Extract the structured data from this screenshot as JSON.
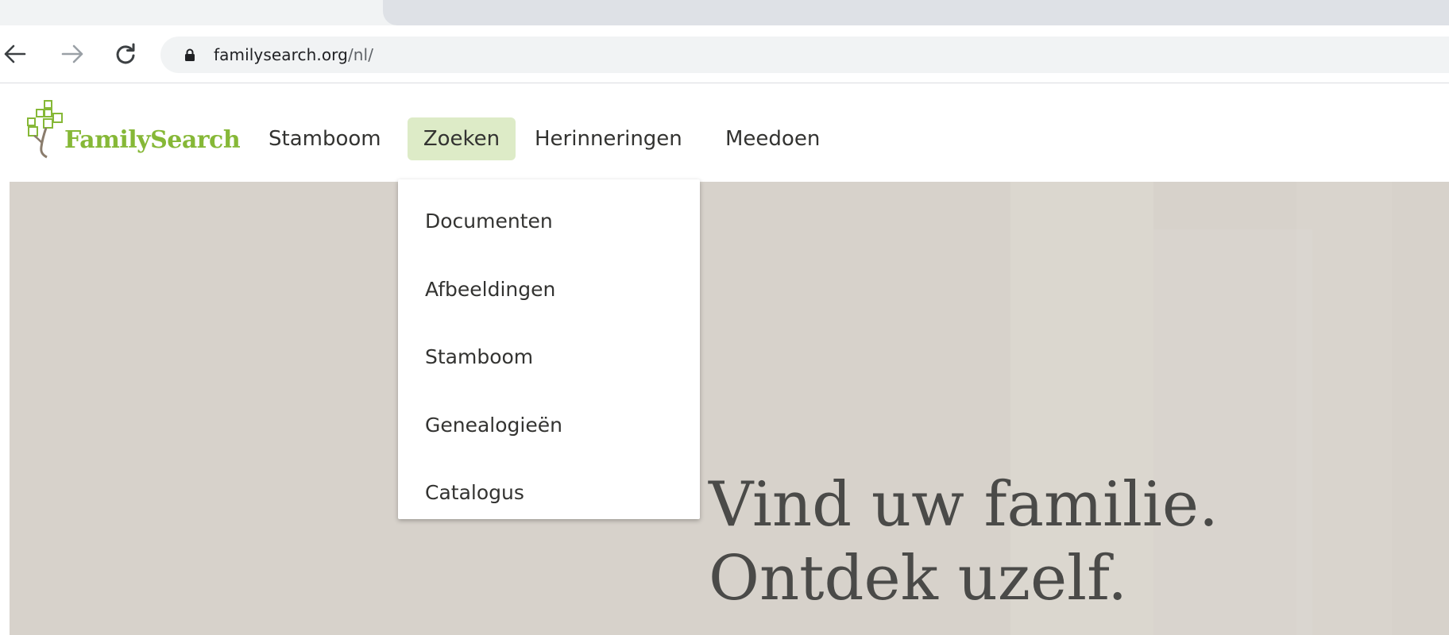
{
  "browser": {
    "url_host": "familysearch.org",
    "url_path": "/nl/"
  },
  "site": {
    "logo_text": "FamilySearch",
    "nav": {
      "stamboom": "Stamboom",
      "zoeken": "Zoeken",
      "herinneringen": "Herinneringen",
      "meedoen": "Meedoen"
    },
    "zoeken_menu": [
      "Documenten",
      "Afbeeldingen",
      "Stamboom",
      "Genealogieën",
      "Catalogus"
    ],
    "hero": {
      "line1": "Vind uw familie.",
      "line2": "Ontdek uzelf."
    }
  },
  "colors": {
    "brand_green": "#86b837",
    "active_nav_bg": "#ddebc7",
    "hero_bg": "#d7d2cb",
    "text": "#333331"
  },
  "icons": {
    "back": "back-arrow-icon",
    "forward": "forward-arrow-icon",
    "reload": "reload-icon",
    "lock": "lock-icon",
    "logo": "family-tree-logo-icon"
  }
}
